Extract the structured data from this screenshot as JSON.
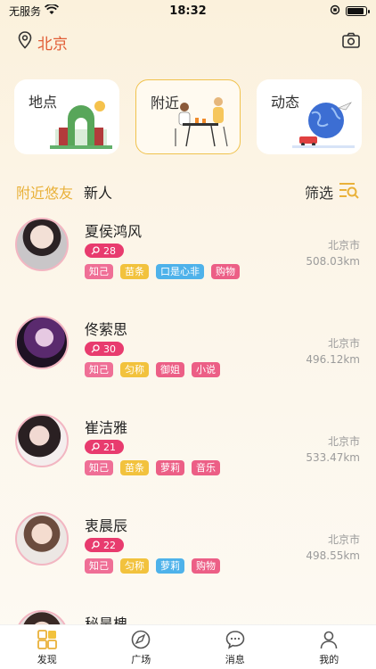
{
  "status": {
    "carrier": "无服务",
    "time": "18:32"
  },
  "location": {
    "city": "北京"
  },
  "cards": [
    {
      "label": "地点"
    },
    {
      "label": "附近"
    },
    {
      "label": "动态"
    }
  ],
  "tabs": {
    "nearby": "附近悠友",
    "new": "新人",
    "filter": "筛选"
  },
  "users": [
    {
      "name": "夏侯鸿风",
      "count": "28",
      "city": "北京市",
      "distance": "508.03km",
      "tags": [
        "知己",
        "苗条",
        "口是心非",
        "购物"
      ]
    },
    {
      "name": "佟萦思",
      "count": "30",
      "city": "北京市",
      "distance": "496.12km",
      "tags": [
        "知己",
        "匀称",
        "御姐",
        "小说"
      ]
    },
    {
      "name": "崔洁雅",
      "count": "21",
      "city": "北京市",
      "distance": "533.47km",
      "tags": [
        "知己",
        "苗条",
        "萝莉",
        "音乐"
      ]
    },
    {
      "name": "衷晨辰",
      "count": "22",
      "city": "北京市",
      "distance": "498.55km",
      "tags": [
        "知己",
        "匀称",
        "萝莉",
        "购物"
      ]
    },
    {
      "name": "秘昊槐"
    }
  ],
  "tabbar": [
    {
      "label": "发现"
    },
    {
      "label": "广场"
    },
    {
      "label": "消息"
    },
    {
      "label": "我的"
    }
  ],
  "colors": {
    "accent": "#e9b13a",
    "location": "#e15d35",
    "badge": "#e83b6e"
  }
}
